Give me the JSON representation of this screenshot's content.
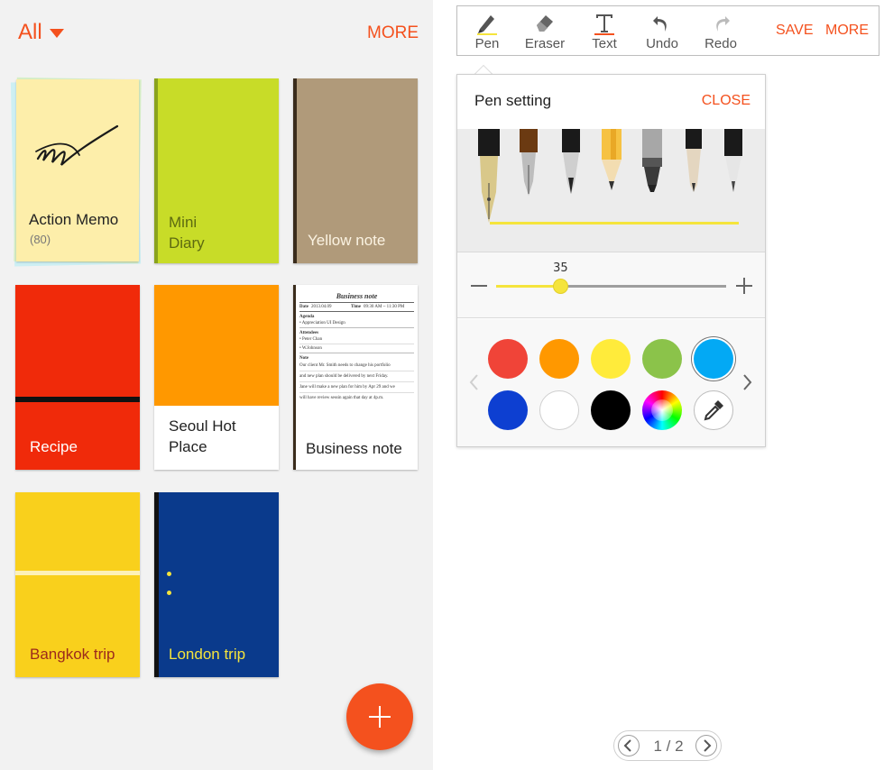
{
  "left": {
    "filter_label": "All",
    "more_label": "MORE",
    "notebooks": [
      {
        "title": "Action Memo",
        "count": "(80)"
      },
      {
        "title": "Mini\nDiary"
      },
      {
        "title": "Yellow note"
      },
      {
        "title": "Recipe"
      },
      {
        "title": "Seoul Hot\nPlace"
      },
      {
        "title": "Business note"
      },
      {
        "title": "Bangkok trip"
      },
      {
        "title": "London trip"
      }
    ],
    "business_note_preview": {
      "heading": "Business note",
      "date_label": "Date",
      "date_value": "2013.04.09",
      "time_label": "Time",
      "time_value": "09:30 AM ~ 11:30 PM",
      "agenda_label": "Agenda",
      "agenda_items": [
        "Appreciation UI Design"
      ],
      "attendees_label": "Attendees",
      "attendees": [
        "Peter Chan",
        "W.Johnson"
      ],
      "note_label": "Note",
      "note_lines": [
        "Our client Mr. Smith needs to change his portfolio",
        "and new plan should be delivered by next Friday.",
        "Jane will make a new plan for him by Apr 29 and we",
        "will have review sessin again that day at 4p.m."
      ]
    }
  },
  "toolbar": {
    "tools": [
      {
        "label": "Pen",
        "icon": "pen-icon"
      },
      {
        "label": "Eraser",
        "icon": "eraser-icon"
      },
      {
        "label": "Text",
        "icon": "text-icon"
      },
      {
        "label": "Undo",
        "icon": "undo-icon"
      },
      {
        "label": "Redo",
        "icon": "redo-icon"
      }
    ],
    "save_label": "SAVE",
    "more_label": "MORE"
  },
  "pen_setting": {
    "title": "Pen setting",
    "close_label": "CLOSE",
    "pens": [
      "fountain-pen",
      "calligraphy-pen",
      "brush-pen",
      "pencil",
      "marker",
      "highlighter",
      "ballpoint-pen"
    ],
    "selected_pen": "fountain-pen",
    "size_value": "35",
    "size_fraction": 0.28,
    "colors_row1": [
      "#f04438",
      "#ff9800",
      "#ffeb3b",
      "#8bc34a",
      "#03a9f4"
    ],
    "colors_row2": [
      "#0d3fd1",
      "#ffffff",
      "#000000",
      "color-wheel",
      "eyedropper"
    ],
    "selected_color": "#03a9f4",
    "stroke_color": "#f5e43c"
  },
  "pager": {
    "text": "1 / 2"
  }
}
